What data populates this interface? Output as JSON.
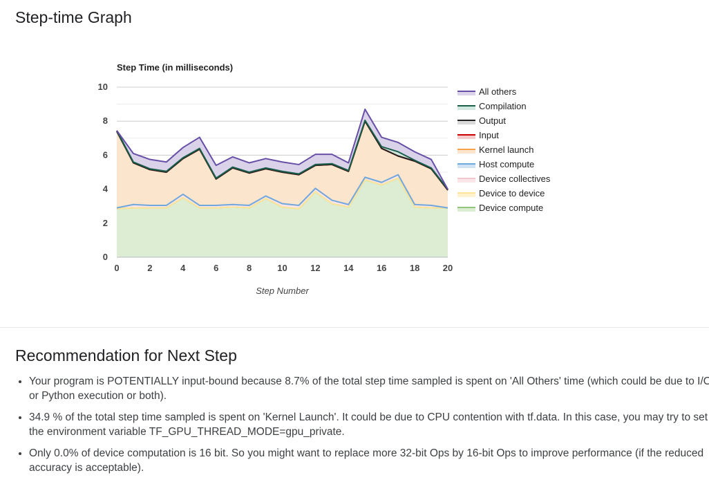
{
  "page": {
    "title": "Step-time Graph",
    "recommendation_title": "Recommendation for Next Step"
  },
  "recommendations": [
    "Your program is POTENTIALLY input-bound because 8.7% of the total step time sampled is spent on 'All Others' time (which could be due to I/O or Python execution or both).",
    "34.9 % of the total step time sampled is spent on 'Kernel Launch'. It could be due to CPU contention with tf.data. In this case, you may try to set the environment variable TF_GPU_THREAD_MODE=gpu_private.",
    "Only 0.0% of device computation is 16 bit. So you might want to replace more 32-bit Ops by 16-bit Ops to improve performance (if the reduced accuracy is acceptable)."
  ],
  "chart_data": {
    "type": "area",
    "stacked": true,
    "title": "Step Time (in milliseconds)",
    "xlabel": "Step Number",
    "ylabel": "",
    "xlim": [
      0,
      20
    ],
    "ylim": [
      0,
      10
    ],
    "x_ticks": [
      0,
      2,
      4,
      6,
      8,
      10,
      12,
      14,
      16,
      18,
      20
    ],
    "y_ticks": [
      0,
      2,
      4,
      6,
      8,
      10
    ],
    "grid": true,
    "legend_position": "right",
    "x": [
      0,
      1,
      2,
      3,
      4,
      5,
      6,
      7,
      8,
      9,
      10,
      11,
      12,
      13,
      14,
      15,
      16,
      17,
      18,
      19,
      20
    ],
    "series": [
      {
        "name": "Device compute",
        "fill": "#dcedd4",
        "stroke": "#93c47d",
        "values": [
          2.85,
          2.9,
          2.9,
          2.9,
          3.5,
          2.9,
          2.9,
          2.95,
          2.9,
          3.45,
          2.95,
          2.85,
          3.85,
          3.15,
          2.95,
          4.55,
          4.25,
          4.65,
          2.95,
          2.9,
          2.9
        ]
      },
      {
        "name": "Device to device",
        "fill": "#fff2cc",
        "stroke": "#ffe599",
        "values": [
          0,
          0,
          0,
          0,
          0,
          0,
          0,
          0,
          0,
          0,
          0,
          0,
          0,
          0,
          0,
          0,
          0,
          0,
          0,
          0,
          0
        ]
      },
      {
        "name": "Device collectives",
        "fill": "#fde6ea",
        "stroke": "#f4c7cf",
        "values": [
          0.05,
          0.2,
          0.15,
          0.15,
          0.2,
          0.15,
          0.15,
          0.15,
          0.15,
          0.15,
          0.2,
          0.2,
          0.2,
          0.2,
          0.15,
          0.15,
          0.15,
          0.2,
          0.15,
          0.15,
          0.0
        ]
      },
      {
        "name": "Host compute",
        "fill": "#cfe2f3",
        "stroke": "#6fa8dc",
        "values": [
          0,
          0,
          0,
          0,
          0,
          0,
          0,
          0,
          0,
          0,
          0,
          0,
          0,
          0,
          0,
          0,
          0,
          0,
          0,
          0,
          0
        ]
      },
      {
        "name": "Kernel launch",
        "fill": "#fce5cd",
        "stroke": "#f6a34a",
        "values": [
          4.5,
          2.45,
          2.1,
          1.95,
          2.1,
          3.3,
          1.55,
          2.15,
          1.9,
          1.6,
          1.85,
          1.8,
          1.35,
          2.1,
          1.95,
          3.3,
          2.0,
          1.1,
          2.55,
          2.15,
          1.05
        ]
      },
      {
        "name": "Input",
        "fill": "#f4cccc",
        "stroke": "#cc0000",
        "values": [
          0,
          0,
          0,
          0,
          0,
          0,
          0,
          0,
          0,
          0,
          0,
          0,
          0,
          0,
          0,
          0,
          0,
          0,
          0,
          0,
          0
        ]
      },
      {
        "name": "Output",
        "fill": "#d9d9d9",
        "stroke": "#222222",
        "values": [
          0,
          0,
          0,
          0,
          0,
          0,
          0,
          0,
          0,
          0,
          0,
          0,
          0,
          0,
          0,
          0,
          0,
          0,
          0,
          0,
          0
        ]
      },
      {
        "name": "Compilation",
        "fill": "#cfe7dd",
        "stroke": "#1b5e4a",
        "values": [
          0.05,
          0.05,
          0.05,
          0.05,
          0.05,
          0.05,
          0.05,
          0.05,
          0.05,
          0.05,
          0.05,
          0.05,
          0.05,
          0.05,
          0.05,
          0.05,
          0.1,
          0.25,
          0.05,
          0.05,
          0.05
        ]
      },
      {
        "name": "All others",
        "fill": "#d9d2e9",
        "stroke": "#674ea7",
        "values": [
          0.0,
          0.5,
          0.55,
          0.55,
          0.6,
          0.65,
          0.75,
          0.6,
          0.55,
          0.55,
          0.55,
          0.55,
          0.6,
          0.55,
          0.45,
          0.65,
          0.55,
          0.55,
          0.5,
          0.5,
          0.0
        ]
      }
    ]
  }
}
